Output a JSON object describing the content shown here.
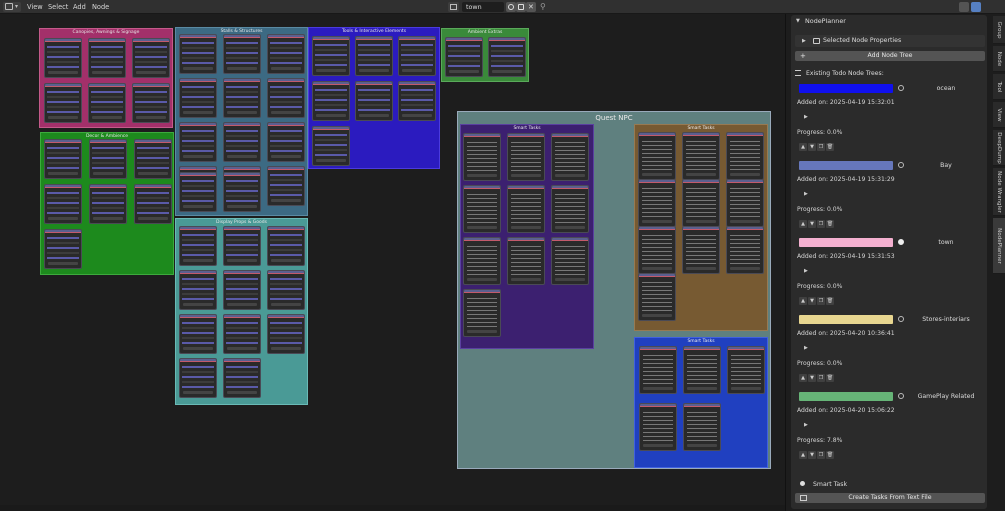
{
  "header": {
    "menu": [
      "View",
      "Select",
      "Add",
      "Node"
    ],
    "node_tree_name": "town"
  },
  "canvas": {
    "frames": [
      {
        "id": "canopies",
        "title": "Canopies, Awnings & Signage",
        "color": "#a3306a"
      },
      {
        "id": "stalls",
        "title": "Stalls & Structures",
        "color": "#3c6a83"
      },
      {
        "id": "tools",
        "title": "Tools & Interactive Elements",
        "color": "#2b1bbf"
      },
      {
        "id": "ambient",
        "title": "Ambient Extras",
        "color": "#3a8a3a"
      },
      {
        "id": "decor",
        "title": "Decor & Ambience",
        "color": "#1d8a1d"
      },
      {
        "id": "display",
        "title": "Display Props & Goods",
        "color": "#4a9a96"
      }
    ],
    "quest_frame": {
      "title": "Quest NPC",
      "color": "#5f807f",
      "subframes": [
        {
          "id": "smart1",
          "title": "Smart Tasks",
          "color": "#3c2070"
        },
        {
          "id": "smart2",
          "title": "Smart Tasks",
          "color": "#775a32"
        },
        {
          "id": "smart3",
          "title": "Smart Tasks",
          "color": "#2040c0"
        }
      ]
    }
  },
  "sidebar": {
    "panel_title": "NodePlanner",
    "selected_node_properties": "Selected Node Properties",
    "add_node_tree": "Add Node Tree",
    "existing_label": "Existing Todo Node Trees:",
    "entries": [
      {
        "name": "ocean",
        "color": "#1010ee",
        "added": "Added on: 2025-04-19 15:32:01",
        "progress": "Progress: 0.0%",
        "active": false
      },
      {
        "name": "Bay",
        "color": "#6677bb",
        "added": "Added on: 2025-04-19 15:31:29",
        "progress": "Progress: 0.0%",
        "active": false
      },
      {
        "name": "town",
        "color": "#f4b0d0",
        "added": "Added on: 2025-04-19 15:31:53",
        "progress": "Progress: 0.0%",
        "active": true
      },
      {
        "name": "Stores-interiars",
        "color": "#e8d690",
        "added": "Added on: 2025-04-20 10:36:41",
        "progress": "Progress: 0.0%",
        "active": false
      },
      {
        "name": "GamePlay Related",
        "color": "#66b477",
        "added": "Added on: 2025-04-20 15:06:22",
        "progress": "Progress: 7.8%",
        "active": false
      }
    ],
    "smart_task": "Smart Task",
    "create_tasks": "Create Tasks From Text File"
  },
  "tabs": [
    "Group",
    "Node",
    "Tool",
    "View",
    "DeepDump",
    "Node Wrangler",
    "NodePlanner"
  ]
}
